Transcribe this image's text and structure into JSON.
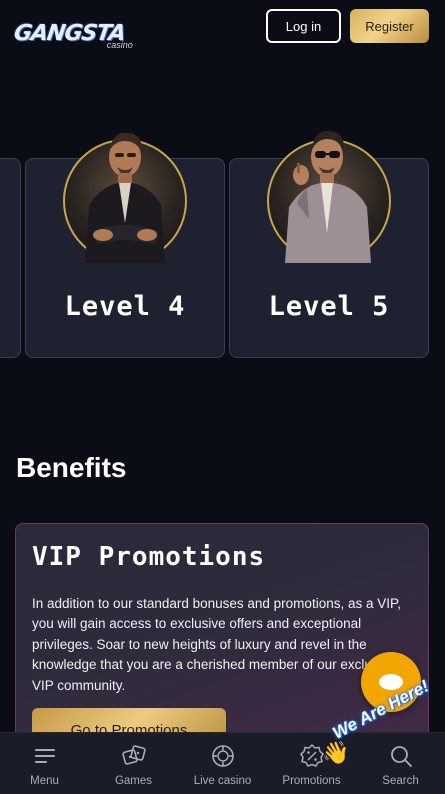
{
  "header": {
    "logo_text": "GANGSTA",
    "logo_sub": "casino",
    "login_label": "Log in",
    "register_label": "Register"
  },
  "levels": [
    {
      "label": "Level 4"
    },
    {
      "label": "Level 5"
    }
  ],
  "benefits": {
    "title": "Benefits",
    "promo": {
      "title": "VIP Promotions",
      "text": "In addition to our standard bonuses and promotions, as a VIP, you will gain access to exclusive offers and exceptional privileges. Soar to new heights of luxury and revel in the knowledge that you are a cherished member of our exclusive VIP community.",
      "button_label": "Go to Promotions"
    }
  },
  "bottom_nav": [
    {
      "label": "Menu",
      "icon": "menu-icon"
    },
    {
      "label": "Games",
      "icon": "dice-icon"
    },
    {
      "label": "Live casino",
      "icon": "chip-icon"
    },
    {
      "label": "Promotions",
      "icon": "discount-badge-icon"
    },
    {
      "label": "Search",
      "icon": "search-icon"
    }
  ],
  "chat_widget": {
    "label": "We Are Here!",
    "emoji": "👋"
  },
  "colors": {
    "background": "#0b0d16",
    "card": "#1d2130",
    "gold": "#d9b15a",
    "chat": "#f4a600"
  }
}
